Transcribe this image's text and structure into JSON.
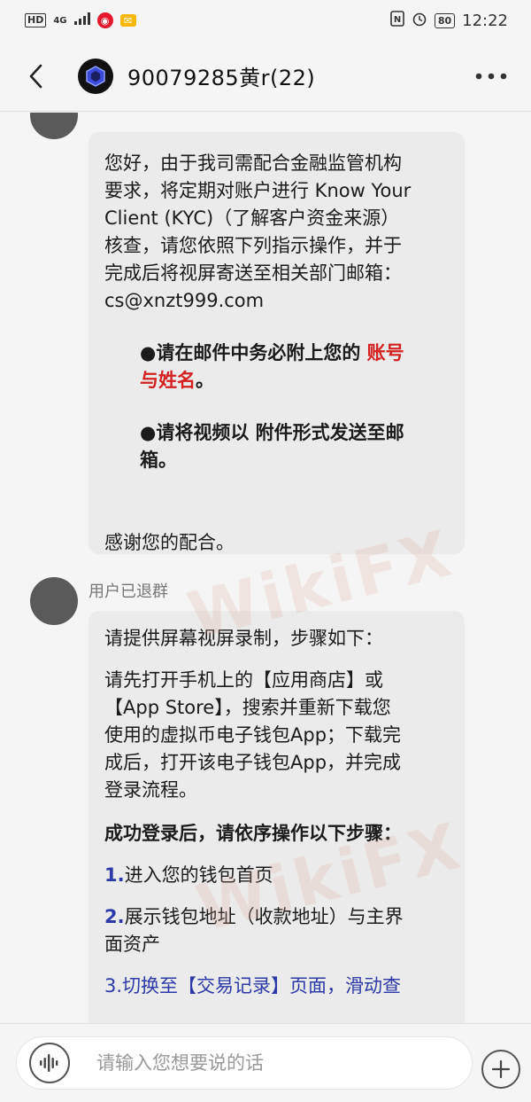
{
  "status_bar": {
    "hd": "HD",
    "signal": "4G",
    "battery": "80",
    "time": "12:22"
  },
  "header": {
    "title": "90079285黄r(22)"
  },
  "messages": [
    {
      "lines": [
        "您好，由于我司需配合金融监管机构",
        "要求，将定期对账户进行 Know Your",
        "Client (KYC)（了解客户资金来源）",
        "核查，请您依照下列指示操作，并于",
        "完成后将视屏寄送至相关部门邮箱：",
        "cs@xnzt999.com"
      ],
      "bullet1_a": "●请在邮件中务必附上您的 ",
      "bullet1_red": "账号",
      "bullet1_red2": "与姓名",
      "bullet1_end": "。",
      "bullet2_line1": "●请将视频以 附件形式发送至邮",
      "bullet2_line2": "箱。",
      "closing": "感谢您的配合。"
    },
    {
      "sender": "用户已退群",
      "intro": "请提供屏幕视屏录制，步骤如下：",
      "lines": [
        "请先打开手机上的【应用商店】或",
        "【App Store】，搜索并重新下载您",
        "使用的虚拟币电子钱包App；下载完",
        "成后，打开该电子钱包App，并完成",
        "登录流程。"
      ],
      "steps_title": "成功登录后，请依序操作以下步骤：",
      "step1_num": "1.",
      "step1": "进入您的钱包首页",
      "step2_num": "2.",
      "step2_line1": "展示钱包地址（收款地址）与主界",
      "step2_line2": "面资产",
      "step3_partial": "3.切换至【交易记录】页面，滑动查"
    }
  ],
  "watermark": "WikiFX",
  "input": {
    "placeholder": "请输入您想要说的话"
  }
}
